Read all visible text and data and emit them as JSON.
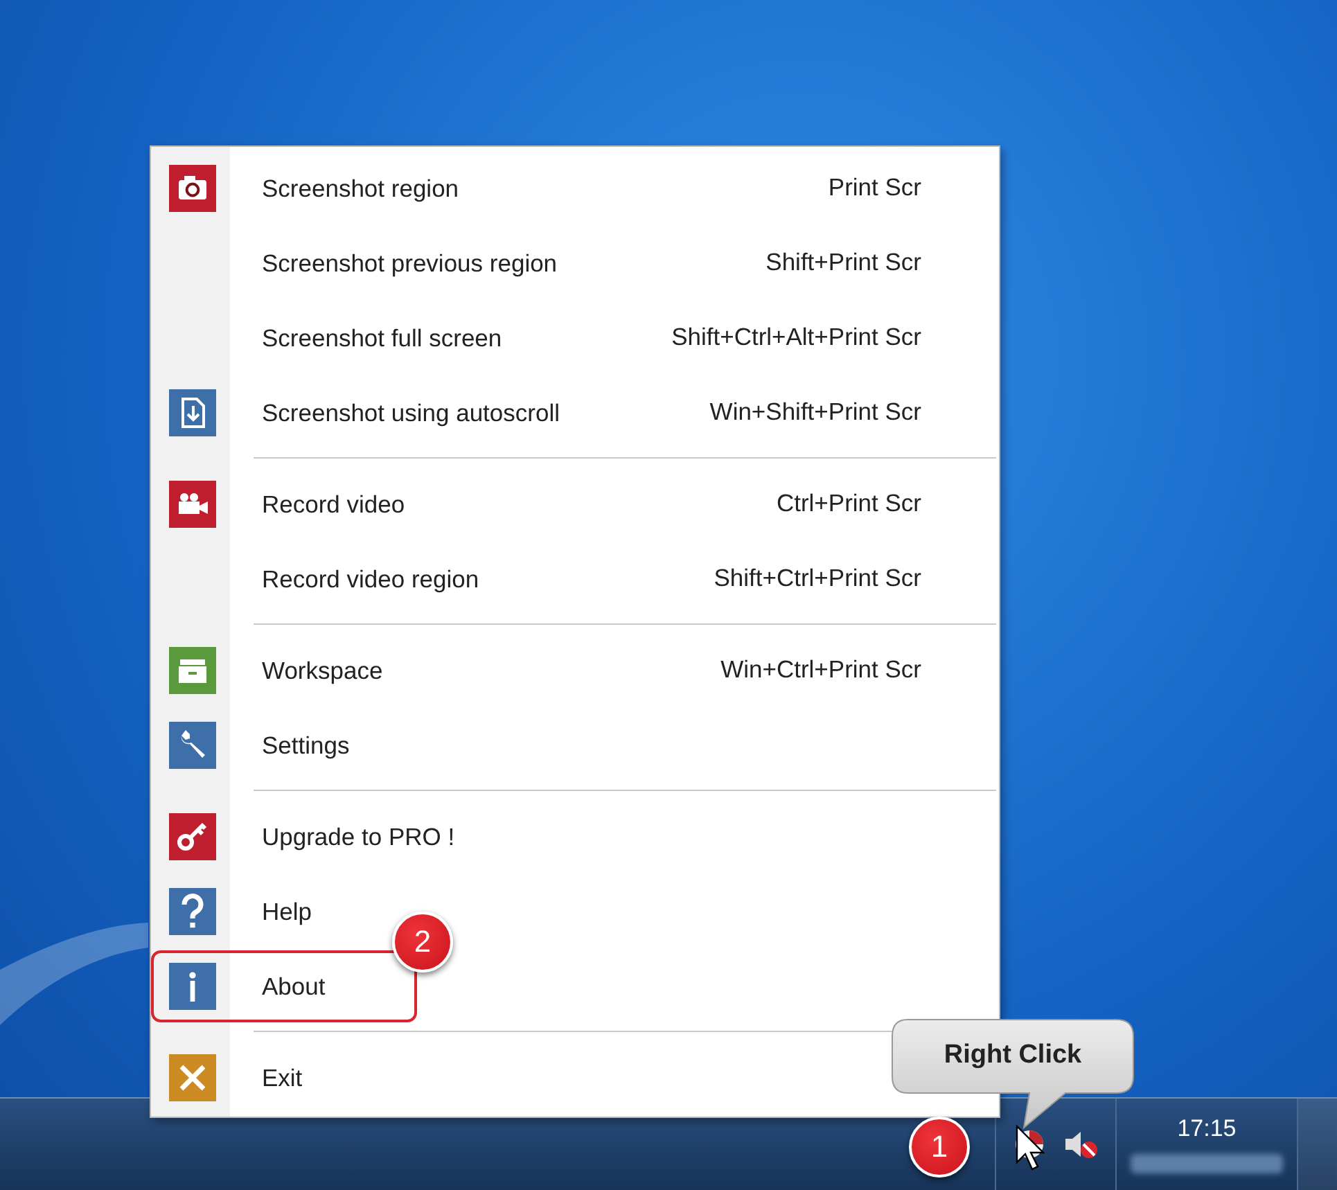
{
  "menu": {
    "groups": [
      {
        "items": [
          {
            "label": "Screenshot region",
            "shortcut": "Print Scr",
            "kind": "camera",
            "color": "#be1e2d",
            "highlighted": false
          },
          {
            "label": "Screenshot previous region",
            "shortcut": "Shift+Print Scr",
            "kind": "plain",
            "highlighted": false
          },
          {
            "label": "Screenshot full screen",
            "shortcut": "Shift+Ctrl+Alt+Print Scr",
            "kind": "plain",
            "highlighted": false
          },
          {
            "label": "Screenshot using autoscroll",
            "shortcut": "Win+Shift+Print Scr",
            "kind": "document",
            "color": "#3e6fa8",
            "highlighted": false
          }
        ]
      },
      {
        "items": [
          {
            "label": "Record video",
            "shortcut": "Ctrl+Print Scr",
            "kind": "video",
            "color": "#be1e2d",
            "highlighted": false
          },
          {
            "label": "Record video region",
            "shortcut": "Shift+Ctrl+Print Scr",
            "kind": "plain",
            "highlighted": false
          }
        ]
      },
      {
        "items": [
          {
            "label": "Workspace",
            "shortcut": "Win+Ctrl+Print Scr",
            "kind": "drawer",
            "color": "#5a9a3c",
            "highlighted": false
          },
          {
            "label": "Settings",
            "kind": "wrench",
            "color": "#3e6fa8",
            "highlighted": false
          }
        ]
      },
      {
        "items": [
          {
            "label": "Upgrade to PRO !",
            "kind": "key",
            "color": "#be1e2d",
            "highlighted": false
          },
          {
            "label": "Help",
            "kind": "question",
            "color": "#3e6fa8",
            "highlighted": false
          },
          {
            "label": "About",
            "kind": "info",
            "color": "#3e6fa8",
            "highlighted": true
          }
        ]
      },
      {
        "items": [
          {
            "label": "Exit",
            "kind": "cross",
            "color": "#cc8a22",
            "highlighted": false
          }
        ]
      }
    ]
  },
  "annotations": [
    {
      "kind": "badge",
      "label": "2"
    },
    {
      "kind": "bubble",
      "label": "Right Click"
    },
    {
      "kind": "badge",
      "label": "1"
    }
  ],
  "taskbar": {
    "clock": "17:15"
  }
}
